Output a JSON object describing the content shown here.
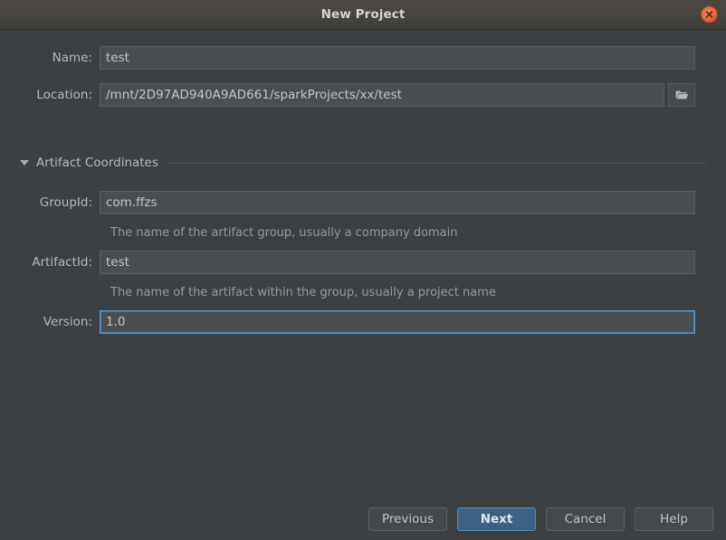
{
  "window": {
    "title": "New Project",
    "close_icon": "close-icon",
    "accent_blue": "#3c6185",
    "focus_blue": "#5d9ad2",
    "close_orange": "#e2663c",
    "background": "#3c4043"
  },
  "form": {
    "name_label": "Name:",
    "name_value": "test",
    "location_label": "Location:",
    "location_value": "/mnt/2D97AD940A9AD661/sparkProjects/xx/test",
    "browse_icon": "folder-icon"
  },
  "section": {
    "title": "Artifact Coordinates",
    "expanded": true,
    "toggle_icon": "chevron-down-icon",
    "fields": [
      {
        "label": "GroupId:",
        "value": "com.ffzs",
        "hint": "The name of the artifact group, usually a company domain",
        "focused": false
      },
      {
        "label": "ArtifactId:",
        "value": "test",
        "hint": "The name of the artifact within the group, usually a project name",
        "focused": false
      },
      {
        "label": "Version:",
        "value": "1.0",
        "hint": "",
        "focused": true
      }
    ]
  },
  "buttons": {
    "previous": "Previous",
    "next": "Next",
    "cancel": "Cancel",
    "help": "Help"
  }
}
